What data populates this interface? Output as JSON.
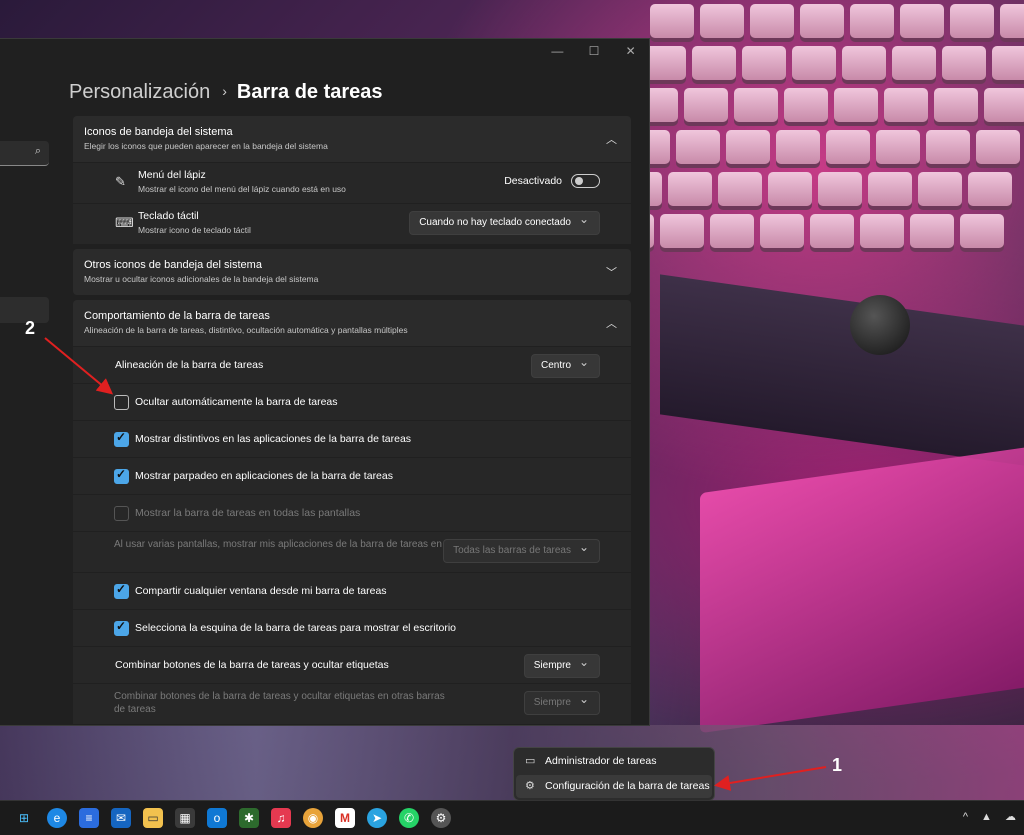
{
  "window": {
    "minimize": "—",
    "maximize": "☐",
    "close": "✕",
    "search_icon": "⌕"
  },
  "breadcrumb": {
    "parent": "Personalización",
    "separator": "›",
    "current": "Barra de tareas"
  },
  "tray_section": {
    "title": "Iconos de bandeja del sistema",
    "subtitle": "Elegir los iconos que pueden aparecer en la bandeja del sistema",
    "pen": {
      "title": "Menú del lápiz",
      "subtitle": "Mostrar el icono del menú del lápiz cuando está en uso",
      "toggle_label": "Desactivado"
    },
    "keyboard": {
      "title": "Teclado táctil",
      "subtitle": "Mostrar icono de teclado táctil",
      "dropdown": "Cuando no hay teclado conectado"
    }
  },
  "other_tray": {
    "title": "Otros iconos de bandeja del sistema",
    "subtitle": "Mostrar u ocultar iconos adicionales de la bandeja del sistema"
  },
  "behavior": {
    "title": "Comportamiento de la barra de tareas",
    "subtitle": "Alineación de la barra de tareas, distintivo, ocultación automática y pantallas múltiples",
    "alignment_label": "Alineación de la barra de tareas",
    "alignment_value": "Centro",
    "autohide": "Ocultar automáticamente la barra de tareas",
    "badges": "Mostrar distintivos en las aplicaciones de la barra de tareas",
    "flashing": "Mostrar parpadeo en aplicaciones de la barra de tareas",
    "all_displays": "Mostrar la barra de tareas en todas las pantallas",
    "multi_label": "Al usar varias pantallas, mostrar mis aplicaciones de la barra de tareas en",
    "multi_value": "Todas las barras de tareas",
    "share": "Compartir cualquier ventana desde mi barra de tareas",
    "corner": "Selecciona la esquina de la barra de tareas para mostrar el escritorio",
    "combine_label": "Combinar botones de la barra de tareas y ocultar etiquetas",
    "combine_value": "Siempre",
    "combine_other_label": "Combinar botones de la barra de tareas y ocultar etiquetas en otras barras de tareas",
    "combine_other_value": "Siempre"
  },
  "context_menu": {
    "task_manager": "Administrador de tareas",
    "taskbar_settings": "Configuración de la barra de tareas"
  },
  "annotations": {
    "one": "1",
    "two": "2"
  },
  "taskbar": {
    "icons": [
      "windows-start-icon",
      "edge-icon",
      "notepad-icon",
      "mail-icon",
      "file-explorer-icon",
      "store-icon",
      "outlook-icon",
      "app-icon",
      "music-icon",
      "chrome-icon",
      "gmail-icon",
      "telegram-icon",
      "whatsapp-icon",
      "settings-icon"
    ],
    "tray_chevron": "^"
  }
}
